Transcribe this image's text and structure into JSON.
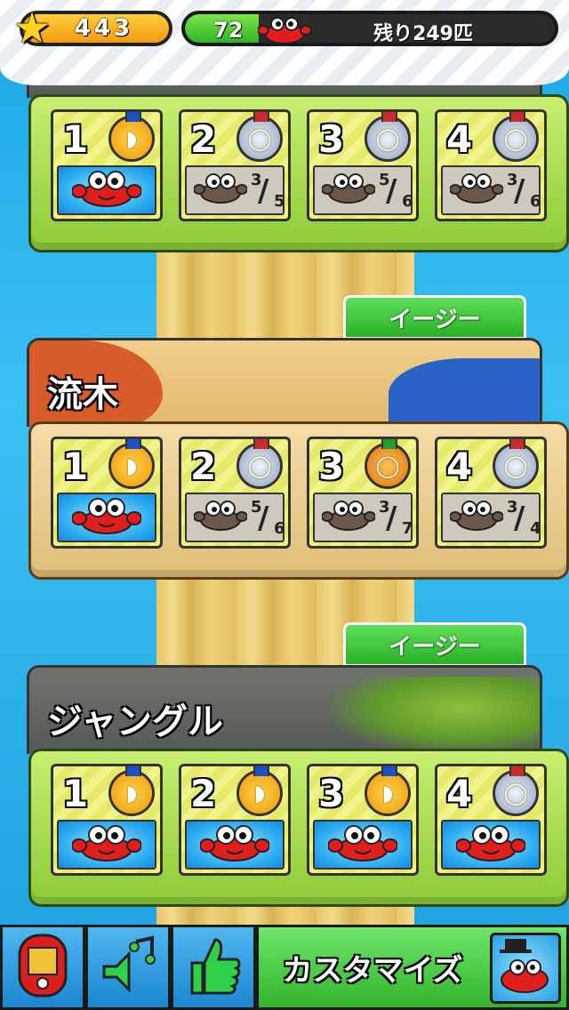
{
  "header": {
    "stars": "443",
    "progress_count": "72",
    "progress_fraction": 0.2,
    "remaining_text": "残り249匹"
  },
  "sections": [
    {
      "tab_label": "",
      "title": "",
      "stages": [
        {
          "num": "1",
          "medal": "gold",
          "cleared": true,
          "caught": "",
          "total": ""
        },
        {
          "num": "2",
          "medal": "silver",
          "cleared": false,
          "caught": "3",
          "total": "5"
        },
        {
          "num": "3",
          "medal": "silver",
          "cleared": false,
          "caught": "5",
          "total": "6"
        },
        {
          "num": "4",
          "medal": "silver",
          "cleared": false,
          "caught": "3",
          "total": "6"
        }
      ]
    },
    {
      "tab_label": "イージー",
      "title": "流木",
      "stages": [
        {
          "num": "1",
          "medal": "gold",
          "cleared": true,
          "caught": "",
          "total": ""
        },
        {
          "num": "2",
          "medal": "silver",
          "cleared": false,
          "caught": "5",
          "total": "6"
        },
        {
          "num": "3",
          "medal": "bronze",
          "cleared": false,
          "caught": "3",
          "total": "7"
        },
        {
          "num": "4",
          "medal": "silver",
          "cleared": false,
          "caught": "3",
          "total": "4"
        }
      ]
    },
    {
      "tab_label": "イージー",
      "title": "ジャングル",
      "stages": [
        {
          "num": "1",
          "medal": "gold",
          "cleared": true,
          "caught": "",
          "total": ""
        },
        {
          "num": "2",
          "medal": "gold",
          "cleared": true,
          "caught": "",
          "total": ""
        },
        {
          "num": "3",
          "medal": "gold",
          "cleared": true,
          "caught": "",
          "total": ""
        },
        {
          "num": "4",
          "medal": "silver",
          "cleared": true,
          "caught": "",
          "total": ""
        }
      ]
    }
  ],
  "toolbar": {
    "jukebox_icon": "jukebox-icon",
    "music_icon": "music-speaker-icon",
    "like_icon": "thumbs-up-icon",
    "customize_label": "カスタマイズ"
  }
}
